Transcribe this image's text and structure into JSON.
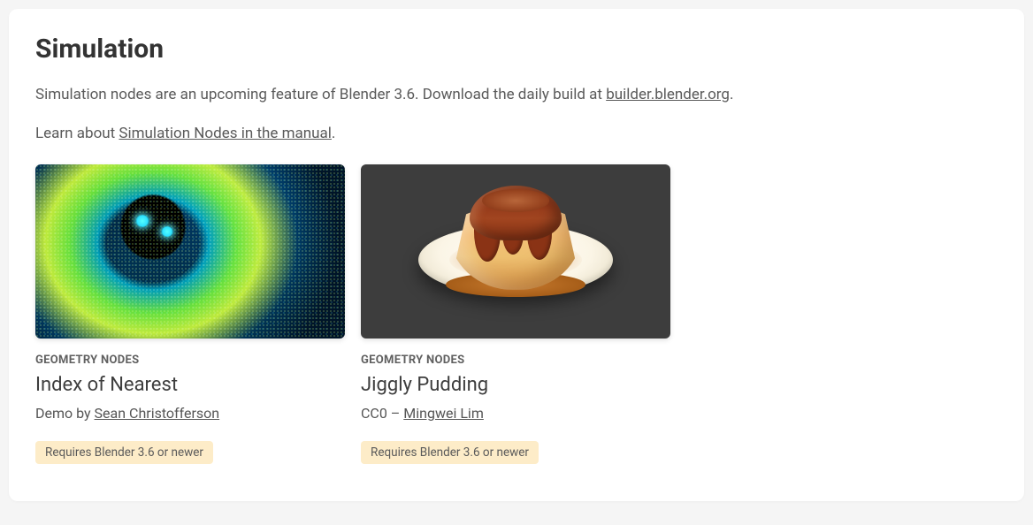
{
  "section": {
    "title": "Simulation",
    "intro_pre": "Simulation nodes are an upcoming feature of Blender 3.6. Download the daily build at ",
    "intro_link": "builder.blender.org",
    "intro_post": ".",
    "learn_pre": "Learn about ",
    "learn_link": "Simulation Nodes in the manual",
    "learn_post": "."
  },
  "demos": [
    {
      "category": "GEOMETRY NODES",
      "title": "Index of Nearest",
      "byline_pre": "Demo by ",
      "byline_link": "Sean Christofferson",
      "byline_post": "",
      "requires": "Requires Blender 3.6 or newer"
    },
    {
      "category": "GEOMETRY NODES",
      "title": "Jiggly Pudding",
      "byline_pre": "CC0 – ",
      "byline_link": "Mingwei Lim",
      "byline_post": "",
      "requires": "Requires Blender 3.6 or newer"
    }
  ]
}
